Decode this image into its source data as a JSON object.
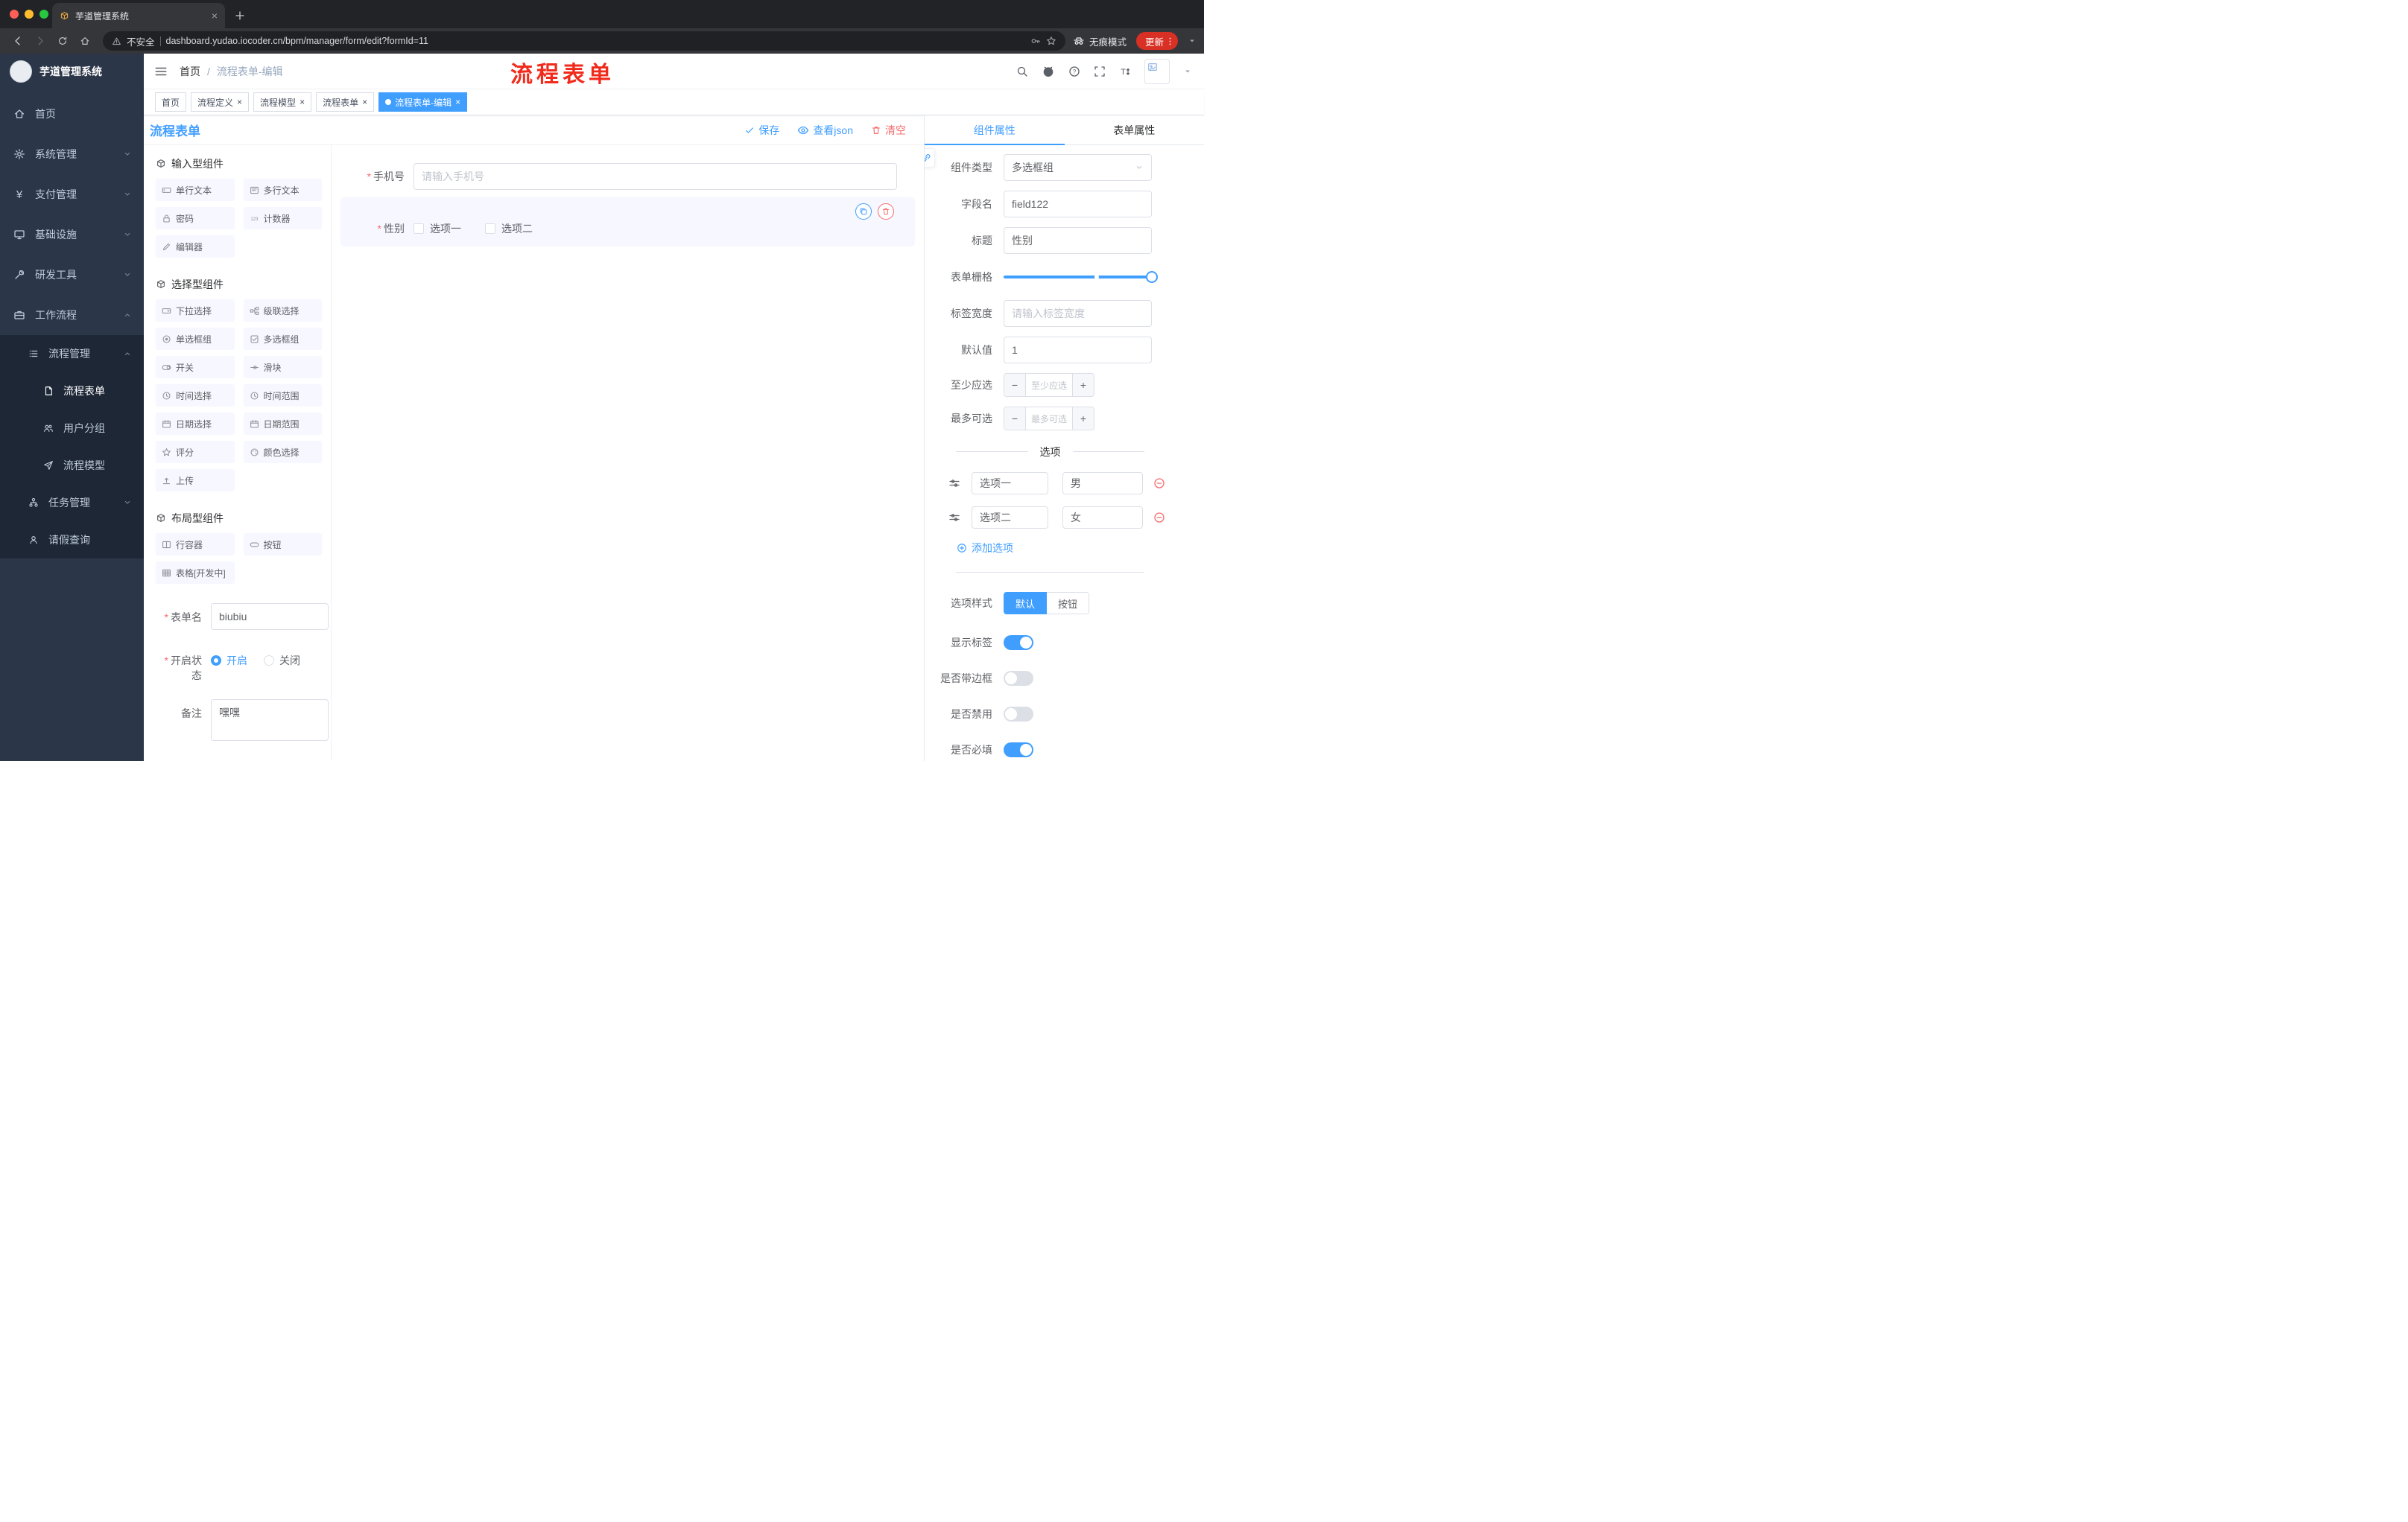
{
  "browser": {
    "tab": {
      "title": "芋道管理系统"
    },
    "address": {
      "security": "不安全",
      "url": "dashboard.yudao.iocoder.cn/bpm/manager/form/edit?formId=11"
    },
    "incognito": "无痕模式",
    "update": "更新"
  },
  "app": {
    "logo": "芋道管理系统",
    "breadcrumb": {
      "home": "首页",
      "current": "流程表单-编辑"
    },
    "annotation": "流程表单"
  },
  "sidebar": {
    "home": "首页",
    "system": "系统管理",
    "pay": "支付管理",
    "infra": "基础设施",
    "dev": "研发工具",
    "workflow": "工作流程",
    "process_mgmt": "流程管理",
    "process_form": "流程表单",
    "user_group": "用户分组",
    "process_model": "流程模型",
    "task_mgmt": "任务管理",
    "leave_query": "请假查询"
  },
  "tags": {
    "t0": "首页",
    "t1": "流程定义",
    "t2": "流程模型",
    "t3": "流程表单",
    "t4": "流程表单-编辑"
  },
  "designer": {
    "title": "流程表单",
    "save": "保存",
    "view_json": "查看json",
    "clear": "清空"
  },
  "panel": {
    "group_input": "输入型组件",
    "group_select": "选择型组件",
    "group_layout": "布局型组件",
    "chips": {
      "c_single": "单行文本",
      "c_multi": "多行文本",
      "c_pwd": "密码",
      "c_counter": "计数器",
      "c_editor": "编辑器",
      "c_select": "下拉选择",
      "c_cascade": "级联选择",
      "c_radio": "单选框组",
      "c_checkbox": "多选框组",
      "c_switch": "开关",
      "c_slider": "滑块",
      "c_time": "时间选择",
      "c_timerange": "时间范围",
      "c_date": "日期选择",
      "c_daterange": "日期范围",
      "c_rate": "评分",
      "c_color": "颜色选择",
      "c_upload": "上传",
      "c_row": "行容器",
      "c_button": "按钮",
      "c_table": "表格[开发中]"
    },
    "form": {
      "name_label": "表单名",
      "name_value": "biubiu",
      "status_label": "开启状态",
      "status_on": "开启",
      "status_off": "关闭",
      "remark_label": "备注",
      "remark_value": "嘿嘿"
    }
  },
  "canvas": {
    "phone": {
      "label": "手机号",
      "placeholder": "请输入手机号"
    },
    "gender": {
      "label": "性别",
      "opt1": "选项一",
      "opt2": "选项二"
    }
  },
  "props": {
    "tab_component": "组件属性",
    "tab_form": "表单属性",
    "type_label": "组件类型",
    "type_value": "多选框组",
    "field_label": "字段名",
    "field_value": "field122",
    "title_label": "标题",
    "title_value": "性别",
    "grid_label": "表单栅格",
    "labelwidth_label": "标签宽度",
    "labelwidth_placeholder": "请输入标签宽度",
    "default_label": "默认值",
    "default_value": "1",
    "min_label": "至少应选",
    "min_placeholder": "至少应选",
    "max_label": "最多可选",
    "max_placeholder": "最多可选",
    "options_divider": "选项",
    "opt1_label": "选项一",
    "opt1_value": "男",
    "opt2_label": "选项二",
    "opt2_value": "女",
    "add_option": "添加选项",
    "style_label": "选项样式",
    "style_default": "默认",
    "style_button": "按钮",
    "show_label": "显示标签",
    "border_label": "是否带边框",
    "disabled_label": "是否禁用",
    "required_label": "是否必填"
  },
  "colors": {
    "primary": "#409eff",
    "danger": "#f56c6c",
    "annotation_red": "#f02b1c",
    "sidebar_bg": "#2b3648",
    "sidebar_sub_bg": "#1d2736",
    "update_button_bg": "#d93025"
  }
}
